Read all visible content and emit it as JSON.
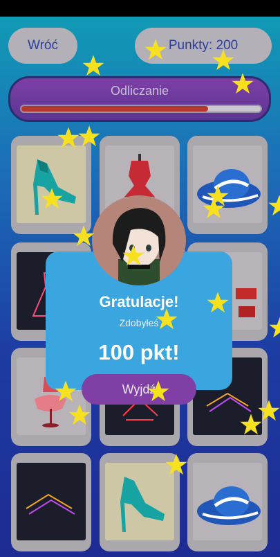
{
  "header": {
    "back_label": "Wróć",
    "points_label": "Punkty: 200"
  },
  "countdown": {
    "title": "Odliczanie",
    "progress": 0.78
  },
  "cards": [
    {
      "row": 1,
      "col": 1,
      "item": "teal-high-heel-sandal"
    },
    {
      "row": 1,
      "col": 2,
      "item": "red-dress-form"
    },
    {
      "row": 1,
      "col": 3,
      "item": "blue-striped-hat"
    },
    {
      "row": 2,
      "col": 1,
      "item": "neon-dress"
    },
    {
      "row": 2,
      "col": 2,
      "item": "hidden"
    },
    {
      "row": 2,
      "col": 3,
      "item": "red-accessory"
    },
    {
      "row": 3,
      "col": 1,
      "item": "pink-tutu-dress-form"
    },
    {
      "row": 3,
      "col": 2,
      "item": "neon-dress"
    },
    {
      "row": 3,
      "col": 3,
      "item": "neon-hangers"
    },
    {
      "row": 4,
      "col": 1,
      "item": "neon-hangers"
    },
    {
      "row": 4,
      "col": 2,
      "item": "teal-high-heel-sandal"
    },
    {
      "row": 4,
      "col": 3,
      "item": "blue-striped-hat"
    }
  ],
  "popup": {
    "title": "Gratulacje!",
    "subtitle": "Zdobyłeś",
    "score": "100 pkt!",
    "exit_label": "Wyjdź"
  },
  "colors": {
    "accent_purple": "#7f3fa4",
    "popup_blue": "#3aa5df",
    "progress_red": "#b5352f",
    "star_yellow": "#f7e11e"
  }
}
